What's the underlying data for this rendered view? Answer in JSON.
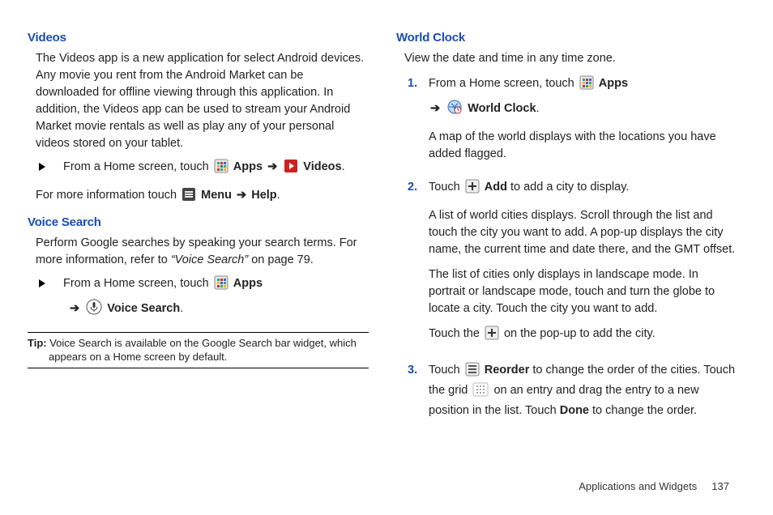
{
  "left": {
    "videos": {
      "heading": "Videos",
      "intro": "The Videos app is a new application for select Android devices. Any movie you rent from the Android Market can be downloaded for offline viewing through this application. In addition, the Videos app can be used to stream your Android Market movie rentals as well as play any of your personal videos stored on your tablet.",
      "bullet_prefix": "From a Home screen, touch ",
      "apps_label": "Apps",
      "arrow": "➔",
      "videos_label": "Videos",
      "more_prefix": "For more information touch ",
      "menu_label": "Menu",
      "help_label": "Help"
    },
    "voice": {
      "heading": "Voice Search",
      "intro_a": "Perform Google searches by speaking your search terms. For more information, refer to ",
      "intro_ref": "“Voice Search”",
      "intro_b": "  on page 79.",
      "bullet_prefix": "From a Home screen, touch ",
      "apps_label": "Apps",
      "arrow": "➔",
      "vs_label": "Voice Search",
      "tip_label": "Tip:",
      "tip_text": " Voice Search is available on the Google Search bar widget, which appears on a Home screen by default."
    }
  },
  "right": {
    "world": {
      "heading": "World Clock",
      "intro": "View the date and time in any time zone.",
      "s1_num": "1.",
      "s1_prefix": "From a Home screen, touch ",
      "apps_label": "Apps",
      "arrow": "➔",
      "wc_label": "World Clock",
      "s1_after": "A map of the world displays with the locations you have added flagged.",
      "s2_num": "2.",
      "s2_prefix": "Touch ",
      "add_label": "Add",
      "s2_suffix": " to add a city to display.",
      "s2_p2": "A list of world cities displays. Scroll through the list and touch the city you want to add. A pop-up displays the city name, the current time and date there, and the GMT offset.",
      "s2_p3": "The list of cities only displays in landscape mode. In portrait or landscape mode, touch and turn the globe to locate a city. Touch the city you want to add.",
      "s2_p4a": "Touch the ",
      "s2_p4b": " on the pop-up to add the city.",
      "s3_num": "3.",
      "s3_prefix": "Touch ",
      "reorder_label": "Reorder",
      "s3_mid1": " to change the order of the cities. Touch the grid ",
      "s3_mid2": " on an entry and drag the entry to a new position in the list. Touch ",
      "done_label": "Done",
      "s3_suffix": " to change the order."
    }
  },
  "footer": {
    "section": "Applications and Widgets",
    "page": "137"
  }
}
